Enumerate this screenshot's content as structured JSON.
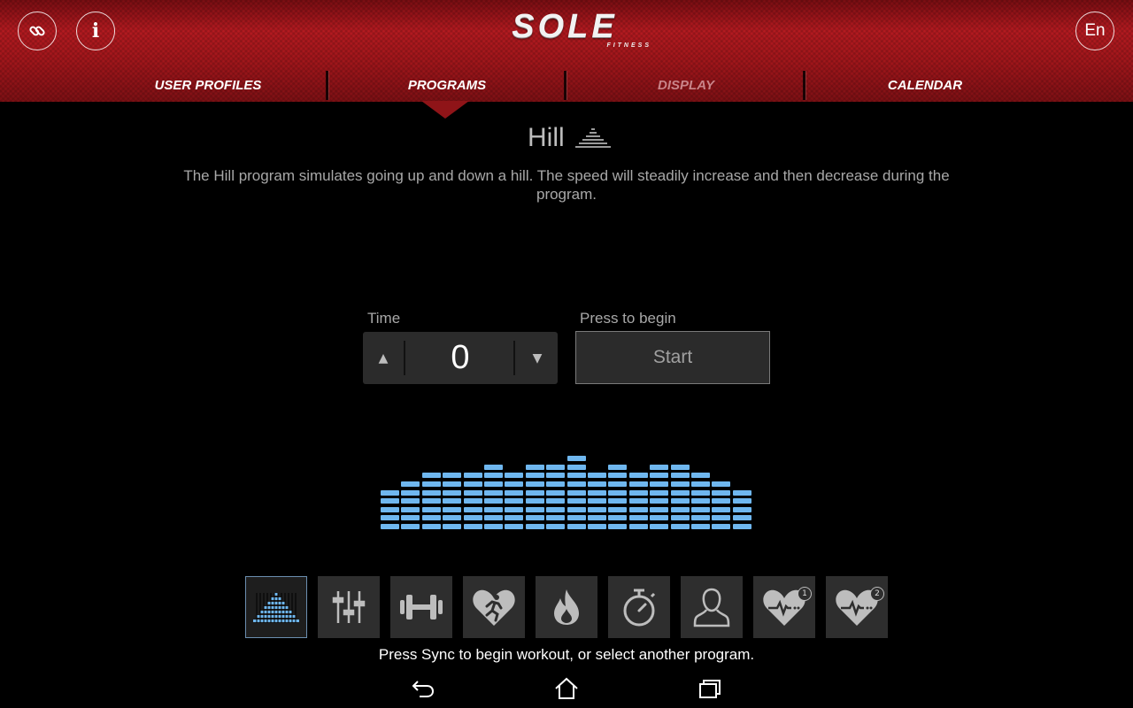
{
  "header": {
    "logo_text": "SOLE",
    "logo_subtext": "FITNESS",
    "language_label": "En"
  },
  "tabs": [
    {
      "label": "USER PROFILES"
    },
    {
      "label": "PROGRAMS"
    },
    {
      "label": "DISPLAY"
    },
    {
      "label": "CALENDAR"
    }
  ],
  "program": {
    "title": "Hill",
    "description": "The Hill program simulates going up and down a hill. The speed will steadily increase and then decrease during the program.",
    "time_label": "Time",
    "time_value": "0",
    "press_label": "Press to begin",
    "start_label": "Start",
    "profile_levels": [
      5,
      6,
      7,
      7,
      7,
      8,
      7,
      8,
      8,
      9,
      7,
      8,
      7,
      8,
      8,
      7,
      6,
      5
    ]
  },
  "program_icons": [
    {
      "name": "hill-icon",
      "selected": true
    },
    {
      "name": "custom-sliders-icon"
    },
    {
      "name": "strength-dumbbell-icon"
    },
    {
      "name": "heart-runner-icon"
    },
    {
      "name": "fat-burn-flame-icon"
    },
    {
      "name": "stopwatch-icon"
    },
    {
      "name": "user-profile-icon"
    },
    {
      "name": "heart-rate-1-icon",
      "badge": "1"
    },
    {
      "name": "heart-rate-2-icon",
      "badge": "2"
    }
  ],
  "hint": "Press Sync to begin workout, or select another program.",
  "colors": {
    "accent_red": "#b51a20",
    "profile_blue": "#6fb7ef",
    "selected_border": "#6c8fb0"
  }
}
